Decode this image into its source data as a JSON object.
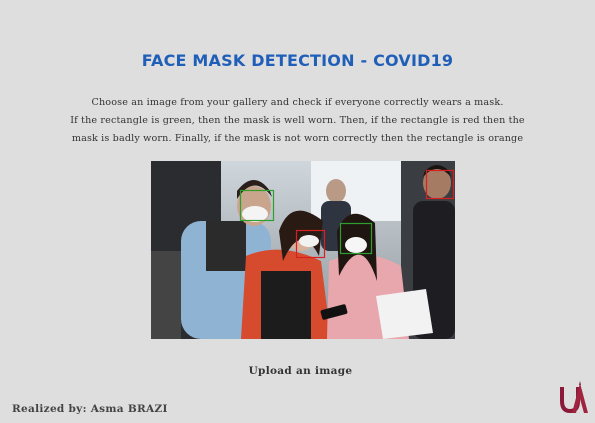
{
  "header": {
    "title": "FACE MASK DETECTION - COVID19"
  },
  "description": {
    "line1": "Choose an image from your gallery and check if everyone correctly wears a mask.",
    "line2": "If the rectangle is green, then the mask is well worn. Then, if the rectangle is red then the",
    "line3": "mask is badly worn. Finally, if the mask is not worn correctly then the rectangle is orange"
  },
  "image": {
    "detections": [
      {
        "status": "well worn",
        "color": "#2e9e2e"
      },
      {
        "status": "well worn",
        "color": "#2e9e2e"
      },
      {
        "status": "badly worn",
        "color": "#d82020"
      },
      {
        "status": "badly worn",
        "color": "#d82020"
      }
    ]
  },
  "upload": {
    "label": "Upload an image"
  },
  "footer": {
    "credit": "Realized by: Asma BRAZI"
  },
  "logo": {
    "icon": "university-logo-icon",
    "color": "#8b1a3a"
  },
  "colors": {
    "background": "#dedede",
    "title": "#1f5fb8",
    "text": "#333333"
  }
}
